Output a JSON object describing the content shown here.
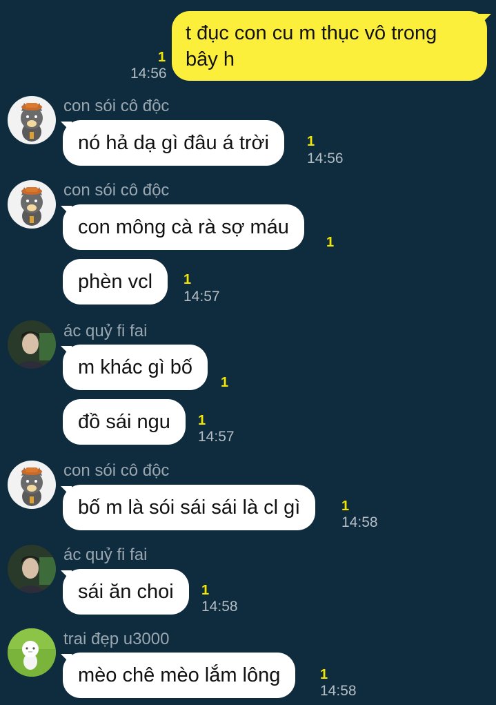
{
  "colors": {
    "background": "#0f2c3f",
    "outgoing": "#fcef3c",
    "incoming": "#ffffff",
    "unread": "#f4e600"
  },
  "messages": [
    {
      "text": "t đục con cu m thục vô trong bây h",
      "count": "1",
      "time": "14:56"
    },
    {
      "sender": "con sói cô độc",
      "text": "nó hả dạ gì đâu á trời",
      "count": "1",
      "time": "14:56"
    },
    {
      "sender": "con sói cô độc",
      "text": "con mông cà rà sợ máu",
      "count": "1"
    },
    {
      "text": "phèn vcl",
      "count": "1",
      "time": "14:57"
    },
    {
      "sender": "ác quỷ fi fai",
      "text": "m khác gì bố",
      "count": "1"
    },
    {
      "text": "đồ sái ngu",
      "count": "1",
      "time": "14:57"
    },
    {
      "sender": "con sói cô độc",
      "text": "bố m là sói sái sái là cl gì",
      "count": "1",
      "time": "14:58"
    },
    {
      "sender": "ác quỷ fi fai",
      "text": "sái ăn choi",
      "count": "1",
      "time": "14:58"
    },
    {
      "sender": "trai đẹp u3000",
      "text": "mèo chê mèo lắm lông",
      "count": "1",
      "time": "14:58"
    }
  ]
}
